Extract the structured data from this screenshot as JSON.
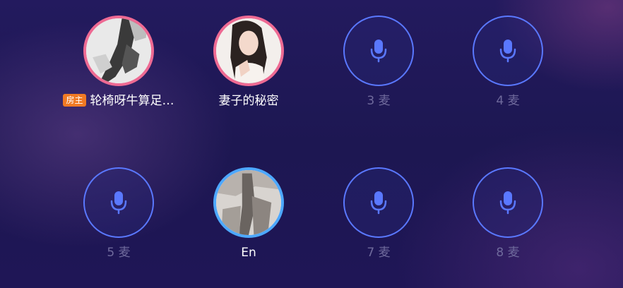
{
  "seats": [
    {
      "label": "轮椅呀牛算足…",
      "badge": "房主",
      "state": "occupied-host"
    },
    {
      "label": "妻子的秘密",
      "state": "occupied-pink"
    },
    {
      "label": "3 麦",
      "state": "empty"
    },
    {
      "label": "4 麦",
      "state": "empty"
    },
    {
      "label": "5 麦",
      "state": "empty"
    },
    {
      "label": "En",
      "state": "occupied-blue"
    },
    {
      "label": "7 麦",
      "state": "empty"
    },
    {
      "label": "8 麦",
      "state": "empty"
    }
  ],
  "icons": {
    "empty_seat": "microphone-icon"
  },
  "colors": {
    "accent_blue": "#5a78ff",
    "host_ring": "#ee6a93",
    "speaker_ring": "#4da8ff",
    "host_badge": "#f07a24"
  }
}
